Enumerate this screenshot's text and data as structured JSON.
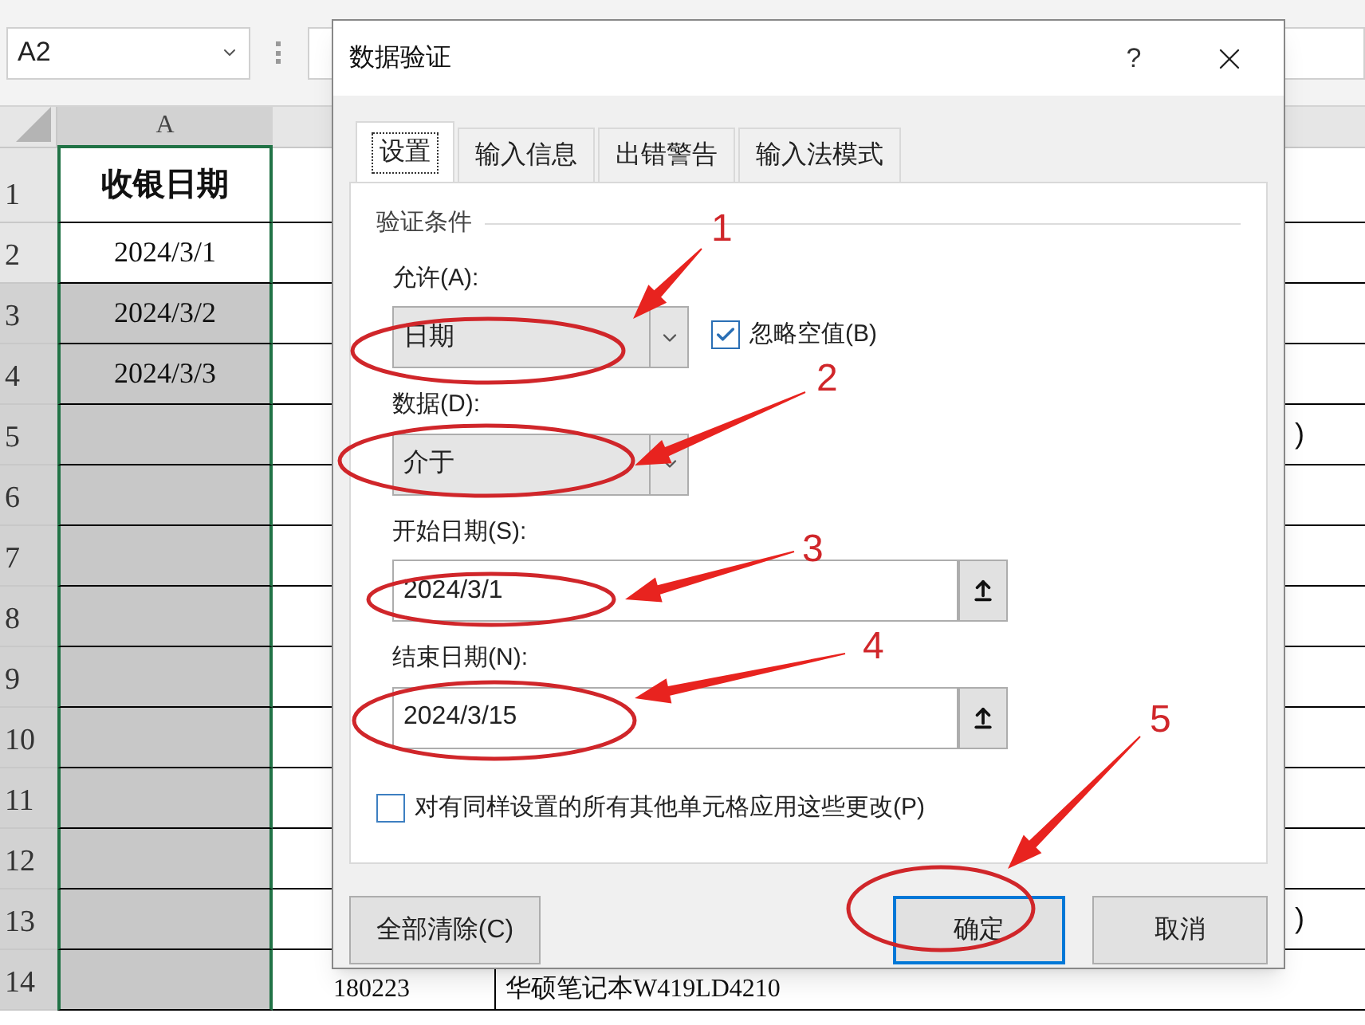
{
  "name_box": {
    "value": "A2"
  },
  "sheet": {
    "column_header": "A",
    "rows": [
      {
        "number": "1",
        "a": "收银日期",
        "kind": "header",
        "selected": false
      },
      {
        "number": "2",
        "a": "2024/3/1",
        "kind": "cell",
        "selected": false
      },
      {
        "number": "3",
        "a": "2024/3/2",
        "kind": "cell",
        "selected": true
      },
      {
        "number": "4",
        "a": "2024/3/3",
        "kind": "cell",
        "selected": true
      },
      {
        "number": "5",
        "kind": "cell",
        "selected": true,
        "d": ")"
      },
      {
        "number": "6",
        "kind": "cell",
        "selected": true
      },
      {
        "number": "7",
        "kind": "cell",
        "selected": true
      },
      {
        "number": "8",
        "kind": "cell",
        "selected": true
      },
      {
        "number": "9",
        "kind": "cell",
        "selected": true
      },
      {
        "number": "10",
        "kind": "cell",
        "selected": true
      },
      {
        "number": "11",
        "kind": "cell",
        "selected": true
      },
      {
        "number": "12",
        "kind": "cell",
        "selected": true
      },
      {
        "number": "13",
        "kind": "cell",
        "selected": true,
        "d": ")"
      },
      {
        "number": "14",
        "kind": "cell",
        "selected": true,
        "b": "180223",
        "c": "华硕笔记本W419LD4210"
      }
    ]
  },
  "dialog": {
    "title": "数据验证",
    "help": "?",
    "tabs": [
      {
        "label": "设置",
        "selected": true
      },
      {
        "label": "输入信息",
        "selected": false
      },
      {
        "label": "出错警告",
        "selected": false
      },
      {
        "label": "输入法模式",
        "selected": false
      }
    ],
    "section": "验证条件",
    "allow": {
      "label": "允许(A):",
      "value": "日期"
    },
    "ignore_blank": {
      "label": "忽略空值(B)",
      "checked": true
    },
    "data": {
      "label": "数据(D):",
      "value": "介于"
    },
    "start_date": {
      "label": "开始日期(S):",
      "value": "2024/3/1"
    },
    "end_date": {
      "label": "结束日期(N):",
      "value": "2024/3/15"
    },
    "apply_all": {
      "label": "对有同样设置的所有其他单元格应用这些更改(P)",
      "checked": false
    },
    "buttons": [
      {
        "label": "全部清除(C)",
        "kind": "clear"
      },
      {
        "label": "确定",
        "kind": "default"
      },
      {
        "label": "取消",
        "kind": "normal"
      }
    ]
  },
  "annotations": [
    {
      "label": "1"
    },
    {
      "label": "2"
    },
    {
      "label": "3"
    },
    {
      "label": "4"
    },
    {
      "label": "5"
    }
  ]
}
